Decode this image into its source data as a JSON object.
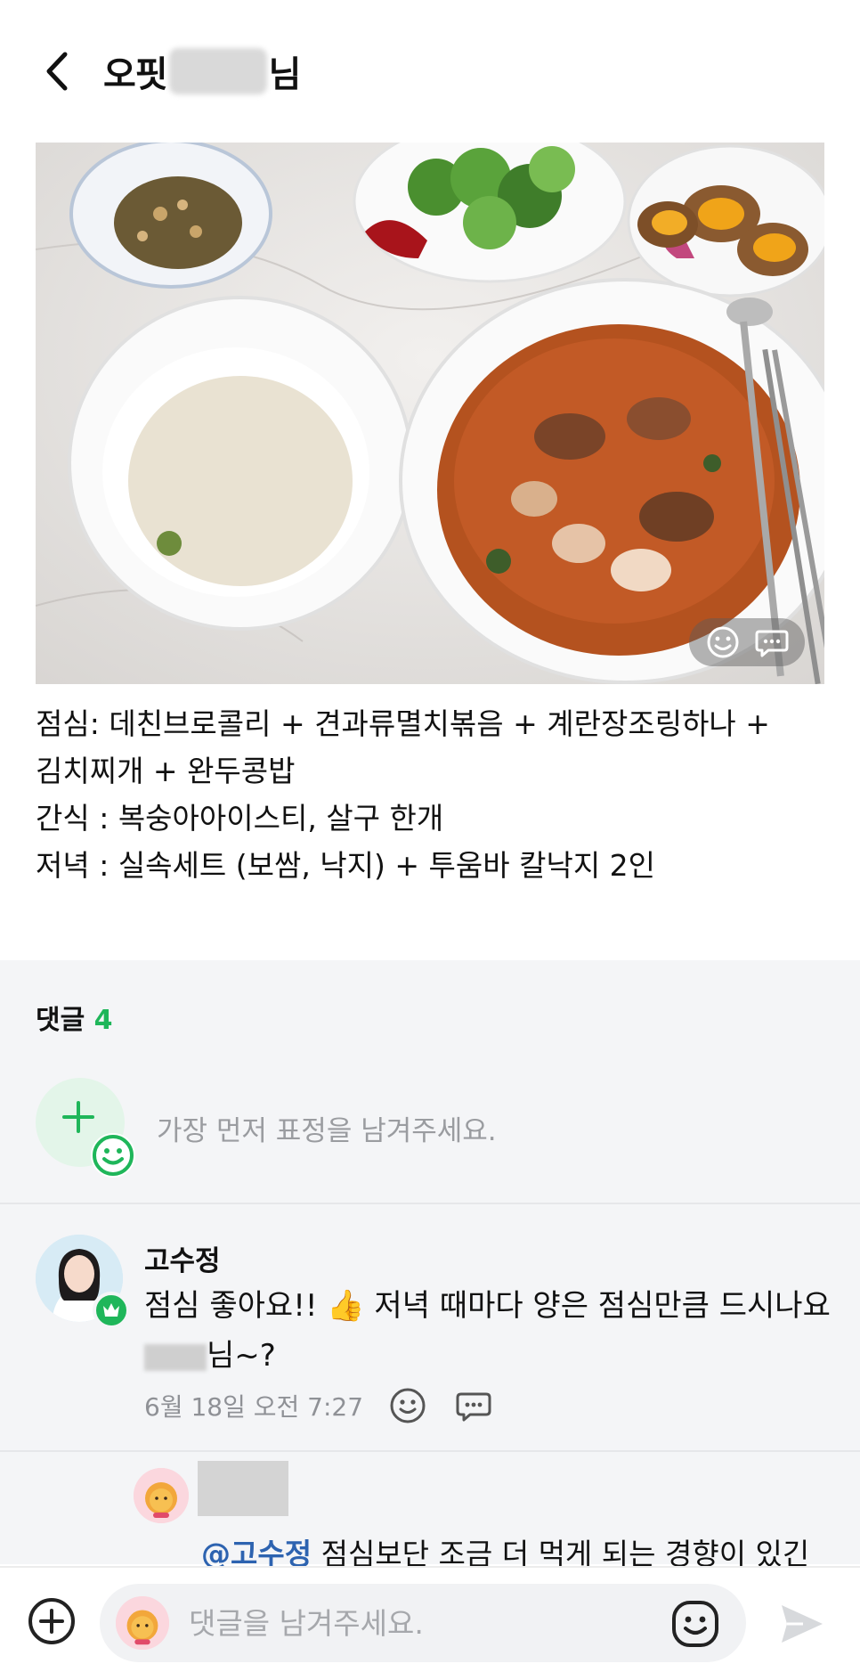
{
  "header": {
    "title_prefix": "오핏",
    "title_suffix": "님"
  },
  "photo": {
    "alt": "meal photo"
  },
  "post": {
    "lines": [
      "점심: 데친브로콜리 + 견과류멸치볶음 + 계란장조링하나 +",
      "김치찌개 + 완두콩밥",
      "간식 : 복숭아아이스티, 살구 한개",
      "저녁 : 실속세트 (보쌈, 낙지) + 투움바 칼낙지 2인"
    ]
  },
  "comments": {
    "label": "댓글",
    "count": "4",
    "reaction_hint": "가장 먼저 표정을 남겨주세요."
  },
  "comment1": {
    "author": "고수정",
    "text_line1": "점심 좋아요!! 👍 저녁 때마다 양은 점심만큼 드시나요",
    "text_line2_suffix": "님~?",
    "date": "6월 18일 오전 7:27"
  },
  "reply1": {
    "mention": "@고수정",
    "text": " 점심보단 조금 더 먹게 되는 경향이 있긴"
  },
  "input": {
    "placeholder": "댓글을 남겨주세요."
  },
  "colors": {
    "accent_green": "#1fb65a",
    "mention_blue": "#2d63b0"
  }
}
